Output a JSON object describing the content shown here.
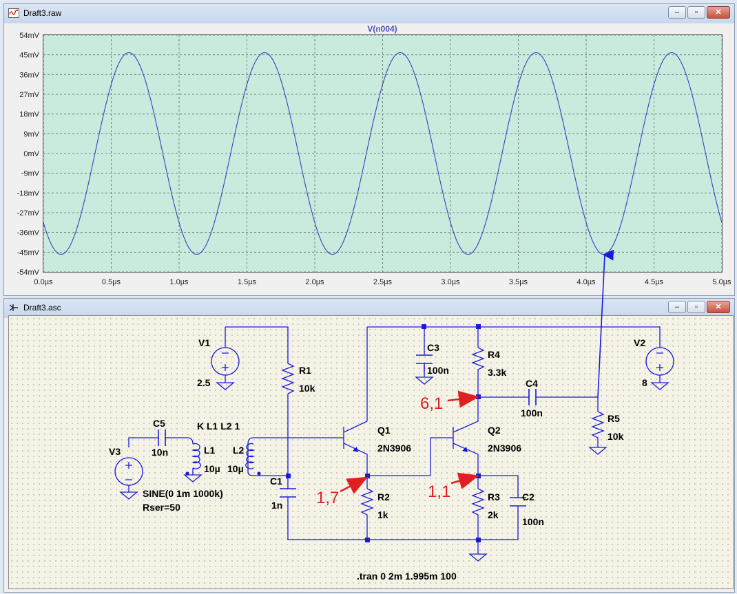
{
  "waveform_window": {
    "title": "Draft3.raw",
    "trace_label": "V(n004)",
    "buttons": {
      "minimize": "–",
      "restore": "▫",
      "close": "✕"
    }
  },
  "schematic_window": {
    "title": "Draft3.asc",
    "buttons": {
      "minimize": "–",
      "restore": "▫",
      "close": "✕"
    }
  },
  "chart_data": {
    "type": "line",
    "title": "V(n004)",
    "xlabel": "",
    "ylabel": "",
    "xlim": [
      0,
      5
    ],
    "ylim": [
      -54,
      54
    ],
    "x_ticks": [
      "0.0µs",
      "0.5µs",
      "1.0µs",
      "1.5µs",
      "2.0µs",
      "2.5µs",
      "3.0µs",
      "3.5µs",
      "4.0µs",
      "4.5µs",
      "5.0µs"
    ],
    "y_ticks": [
      "54mV",
      "45mV",
      "36mV",
      "27mV",
      "18mV",
      "9mV",
      "0mV",
      "-9mV",
      "-18mV",
      "-27mV",
      "-36mV",
      "-45mV",
      "-54mV"
    ],
    "grid": true,
    "series": [
      {
        "name": "V(n004)",
        "color": "#3b3fbf",
        "description_values": {
          "amplitude_mV": 46,
          "period_us": 1.0,
          "first_min_us": 0.13,
          "first_max_us": 0.63,
          "start_value_mV": -32,
          "end_value_mV": -32
        }
      }
    ]
  },
  "schematic": {
    "components": {
      "V1": {
        "name": "V1",
        "value": "2.5"
      },
      "V2": {
        "name": "V2",
        "value": "8"
      },
      "V3": {
        "name": "V3",
        "value_line1": "SINE(0 1m 1000k)",
        "value_line2": "Rser=50"
      },
      "R1": {
        "name": "R1",
        "value": "10k"
      },
      "R2": {
        "name": "R2",
        "value": "1k"
      },
      "R3": {
        "name": "R3",
        "value": "2k"
      },
      "R4": {
        "name": "R4",
        "value": "3.3k"
      },
      "R5": {
        "name": "R5",
        "value": "10k"
      },
      "C1": {
        "name": "C1",
        "value": "1n"
      },
      "C2": {
        "name": "C2",
        "value": "100n"
      },
      "C3": {
        "name": "C3",
        "value": "100n"
      },
      "C4": {
        "name": "C4",
        "value": "100n"
      },
      "C5": {
        "name": "C5",
        "value": "10n"
      },
      "L1": {
        "name": "L1",
        "value": "10µ"
      },
      "L2": {
        "name": "L2",
        "value": "10µ"
      },
      "Q1": {
        "name": "Q1",
        "value": "2N3906"
      },
      "Q2": {
        "name": "Q2",
        "value": "2N3906"
      }
    },
    "coupling": "K L1 L2 1",
    "directive": ".tran 0 2m 1.995m 100",
    "annotations": [
      {
        "label": "6,1"
      },
      {
        "label": "1,7"
      },
      {
        "label": "1,1"
      }
    ],
    "annotation_color": "#e02020",
    "wire_color": "#1a1adc"
  }
}
